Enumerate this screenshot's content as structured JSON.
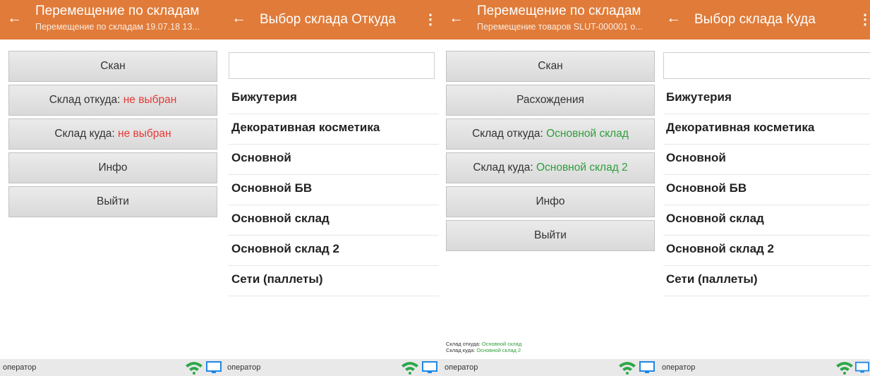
{
  "status_bar": {
    "operator": "оператор"
  },
  "colors": {
    "header": "#e07b39",
    "not_selected": "#e53935",
    "selected": "#2e9e3a"
  },
  "icons": {
    "back": "arrow-left-icon",
    "menu": "more-vertical-icon",
    "wifi": "wifi-icon",
    "monitor": "monitor-icon"
  },
  "panel1": {
    "title": "Перемещение по складам",
    "subtitle": "Перемещение по складам 19.07.18 13...",
    "scan": "Скан",
    "from_label": "Склад откуда: ",
    "from_value": "не выбран",
    "to_label": "Склад куда: ",
    "to_value": "не выбран",
    "info": "Инфо",
    "exit": "Выйти"
  },
  "panel2": {
    "title": "Выбор склада Откуда",
    "items": [
      "Бижутерия",
      "Декоративная косметика",
      "Основной",
      "Основной БВ",
      "Основной склад",
      "Основной склад 2",
      "Сети (паллеты)"
    ]
  },
  "panel3": {
    "title": "Перемещение по складам",
    "subtitle": "Перемещение товаров SLUT-000001 о...",
    "scan": "Скан",
    "diff": "Расхождения",
    "from_label": "Склад откуда: ",
    "from_value": "Основной склад",
    "to_label": "Склад куда: ",
    "to_value": "Основной склад 2",
    "info": "Инфо",
    "exit": "Выйти",
    "footer_from_label": "Склад откуда: ",
    "footer_from_value": "Основной склад",
    "footer_to_label": "Склад куда: ",
    "footer_to_value": "Основной склад 2"
  },
  "panel4": {
    "title": "Выбор склада Куда",
    "items": [
      "Бижутерия",
      "Декоративная косметика",
      "Основной",
      "Основной БВ",
      "Основной склад",
      "Основной склад 2",
      "Сети (паллеты)"
    ]
  }
}
